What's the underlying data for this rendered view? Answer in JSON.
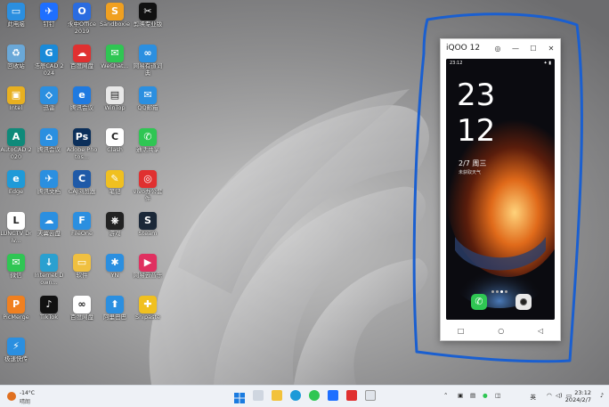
{
  "desktop_icons": [
    {
      "label": "此电脑",
      "color": "#2b8fe0",
      "glyph": "▭"
    },
    {
      "label": "钉钉",
      "color": "#1e6fff",
      "glyph": "✈"
    },
    {
      "label": "永中Office 2019",
      "color": "#2a6ce0",
      "glyph": "O"
    },
    {
      "label": "Sandboxie",
      "color": "#f0a020",
      "glyph": "S"
    },
    {
      "label": "剪映专业版",
      "color": "#111111",
      "glyph": "✂"
    },
    {
      "label": "回收站",
      "color": "#6aa8d8",
      "glyph": "♻"
    },
    {
      "label": "浩辰CAD 2024",
      "color": "#1a8ad8",
      "glyph": "G"
    },
    {
      "label": "百度网盘",
      "color": "#e03030",
      "glyph": "☁"
    },
    {
      "label": "WeChat...",
      "color": "#2fc653",
      "glyph": "✉"
    },
    {
      "label": "网易有道词典",
      "color": "#2b8fe0",
      "glyph": "∞"
    },
    {
      "label": "Intel",
      "color": "#e8b020",
      "glyph": "▣"
    },
    {
      "label": "迅雷",
      "color": "#2b8fe0",
      "glyph": "⬦"
    },
    {
      "label": "腾讯会议",
      "color": "#1f7ae0",
      "glyph": "e"
    },
    {
      "label": "WinTop",
      "color": "#e8e8e8",
      "glyph": "▤"
    },
    {
      "label": "QQ邮箱",
      "color": "#2b8fe0",
      "glyph": "✉"
    },
    {
      "label": "AutoCAD 2020",
      "color": "#0f8a7a",
      "glyph": "A"
    },
    {
      "label": "腾讯会议",
      "color": "#2b8fe0",
      "glyph": "⌂"
    },
    {
      "label": "Adobe Photos...",
      "color": "#0b2f5a",
      "glyph": "Ps"
    },
    {
      "label": "Clash",
      "color": "#ffffff",
      "glyph": "C"
    },
    {
      "label": "通话共享",
      "color": "#2fc653",
      "glyph": "✆"
    },
    {
      "label": "Edge",
      "color": "#1f9ad8",
      "glyph": "e"
    },
    {
      "label": "腾讯文档",
      "color": "#2b8fe0",
      "glyph": "✈"
    },
    {
      "label": "CAJ浏览器",
      "color": "#1f5aa8",
      "glyph": "C"
    },
    {
      "label": "笔记",
      "color": "#f0c020",
      "glyph": "✎"
    },
    {
      "label": "vivo办公套件",
      "color": "#e03030",
      "glyph": "◎"
    },
    {
      "label": "LUNCTV Driv...",
      "color": "#ffffff",
      "glyph": "L"
    },
    {
      "label": "天翼云盘",
      "color": "#2b8fe0",
      "glyph": "☁"
    },
    {
      "label": "FileOne",
      "color": "#2b8fe0",
      "glyph": "F"
    },
    {
      "label": "游戏",
      "color": "#222222",
      "glyph": "⎈"
    },
    {
      "label": "Steam",
      "color": "#1b2838",
      "glyph": "S"
    },
    {
      "label": "微信",
      "color": "#2fc653",
      "glyph": "✉"
    },
    {
      "label": "Internet Down...",
      "color": "#2aa0d0",
      "glyph": "↓"
    },
    {
      "label": "软件",
      "color": "#f0c040",
      "glyph": "▭"
    },
    {
      "label": "YN",
      "color": "#2b8fe0",
      "glyph": "✱"
    },
    {
      "label": "网易云音乐",
      "color": "#e03060",
      "glyph": "▶"
    },
    {
      "label": "PicMerge",
      "color": "#f08020",
      "glyph": "P"
    },
    {
      "label": "TikTok",
      "color": "#111111",
      "glyph": "♪"
    },
    {
      "label": "百度网盘",
      "color": "#ffffff",
      "glyph": "∞"
    },
    {
      "label": "阿里巴巴",
      "color": "#2b8fe0",
      "glyph": "⬆"
    },
    {
      "label": "Snipaste",
      "color": "#f0c020",
      "glyph": "✚"
    },
    {
      "label": "极速快传",
      "color": "#2b8fe0",
      "glyph": "⚡"
    }
  ],
  "phone_window": {
    "title": "iQOO 12",
    "status_time": "23:12",
    "status_icons": "✦ ▮",
    "clock_hour": "23",
    "clock_min": "12",
    "date": "2/7 周三",
    "weather": "未获取天气"
  },
  "taskbar": {
    "weather_temp": "-14°C",
    "weather_desc": "晴朗",
    "ime": "英",
    "time": "23:12",
    "date": "2024/2/7"
  },
  "colors": {
    "taskbar_bg": "#eef1f6",
    "annotation_blue": "#1a5fd0"
  }
}
